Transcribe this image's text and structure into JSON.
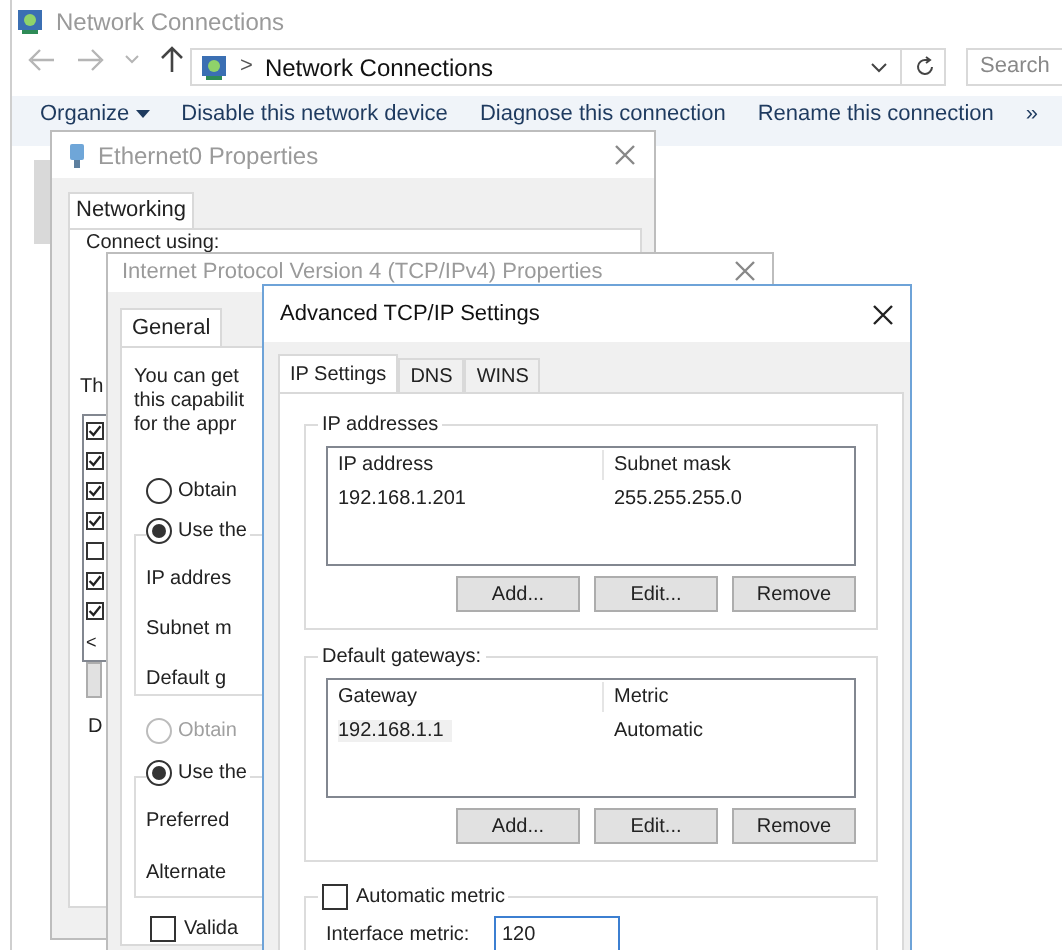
{
  "explorer": {
    "title": "Network Connections",
    "breadcrumb_separator": ">",
    "breadcrumb": "Network Connections",
    "search": {
      "placeholder": "Search"
    },
    "toolbar": [
      "Organize",
      "Disable this network device",
      "Diagnose this connection",
      "Rename this connection",
      "»"
    ]
  },
  "ethernet_window": {
    "title": "Ethernet0 Properties",
    "tabs": [
      {
        "label": "Networking",
        "selected": true
      }
    ],
    "connect_label": "Connect using:",
    "list_label": "Th",
    "items": [
      {
        "checked": true
      },
      {
        "checked": true
      },
      {
        "checked": true
      },
      {
        "checked": true
      },
      {
        "checked": false
      },
      {
        "checked": true
      },
      {
        "checked": true
      }
    ],
    "scroll_arrow": "<",
    "group_label": "D"
  },
  "ipv4_window": {
    "title": "Internet Protocol Version 4 (TCP/IPv4) Properties",
    "tabs": [
      {
        "label": "General",
        "selected": true
      }
    ],
    "intro": [
      "You can get",
      "this capabilit",
      "for the appr"
    ],
    "ip_radios": [
      {
        "label": "Obtain",
        "selected": false,
        "disabled": false
      },
      {
        "label": "Use the",
        "selected": true,
        "disabled": false
      }
    ],
    "ip_fields": [
      "IP addres",
      "Subnet m",
      "Default g"
    ],
    "dns_radios": [
      {
        "label": "Obtain",
        "selected": false,
        "disabled": true
      },
      {
        "label": "Use the",
        "selected": true,
        "disabled": false
      }
    ],
    "dns_fields": [
      "Preferred",
      "Alternate"
    ],
    "validate": {
      "label": "Valida",
      "checked": false
    }
  },
  "advanced_window": {
    "title": "Advanced TCP/IP Settings",
    "tabs": [
      {
        "label": "IP Settings",
        "selected": true
      },
      {
        "label": "DNS",
        "selected": false
      },
      {
        "label": "WINS",
        "selected": false
      }
    ],
    "groups": [
      {
        "label": "IP addresses",
        "columns": [
          "IP address",
          "Subnet mask"
        ],
        "rows": [
          [
            "192.168.1.201",
            "255.255.255.0"
          ]
        ],
        "buttons": [
          "Add...",
          "Edit...",
          "Remove"
        ]
      },
      {
        "label": "Default gateways:",
        "columns": [
          "Gateway",
          "Metric"
        ],
        "rows": [
          [
            "192.168.1.1",
            "Automatic"
          ]
        ],
        "buttons": [
          "Add...",
          "Edit...",
          "Remove"
        ]
      }
    ],
    "automatic_metric": {
      "label": "Automatic metric",
      "checked": false
    },
    "interface_metric": {
      "label": "Interface metric:",
      "value": "120"
    }
  }
}
